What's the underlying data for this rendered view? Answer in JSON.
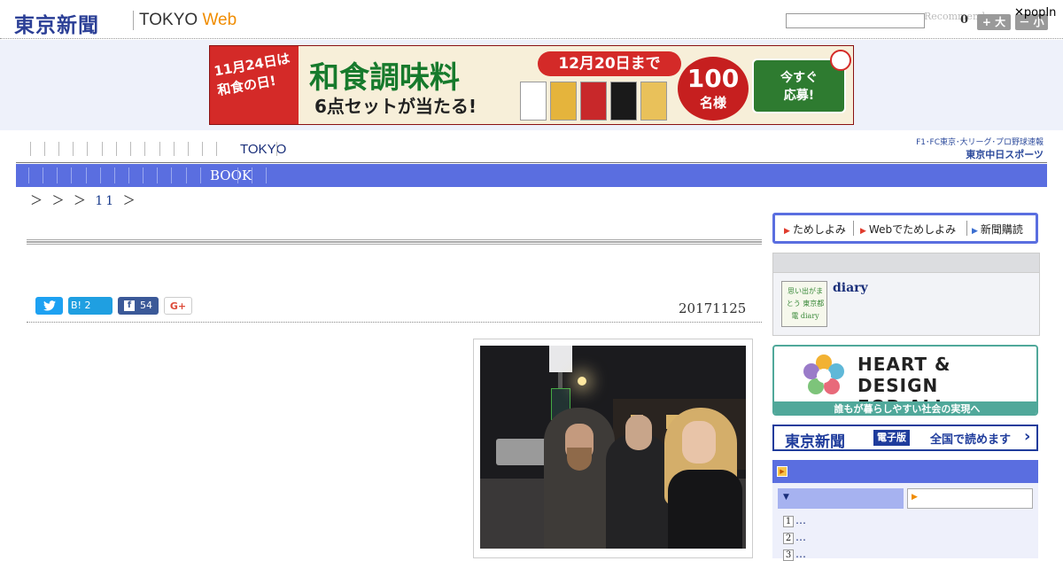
{
  "header": {
    "logo": "東京新聞",
    "site_name_prefix": "TOKYO ",
    "site_name_suffix": "Web",
    "search_placeholder": "",
    "recommend_label": "Recommend",
    "font_size_value": "0",
    "font_larger_label": "+ 大",
    "font_smaller_label": "－ 小",
    "popin_label": "✕popIn"
  },
  "ad": {
    "left_text_1": "11月24日は",
    "left_text_2": "和食の日!",
    "title": "和食調味料",
    "subtitle": "6点セットが当たる!",
    "deadline": "12月20日まで",
    "count": "100",
    "count_unit": "名様",
    "cta_line1": "今すぐ",
    "cta_line2": "応募!"
  },
  "nav": {
    "tokyo_label": "TOKYO",
    "chunichi_top": "F1･FC東京･大リーグ･プロ野球速報",
    "chunichi_bottom": "東京中日スポーツ",
    "book_label": "BOOK"
  },
  "breadcrumb": {
    "prefix": "＞ ＞ ＞",
    "link": "11",
    "suffix": "＞"
  },
  "article": {
    "date": "20171125",
    "share": {
      "twitter_icon": "twitter-icon",
      "hatena_label": "B! 2",
      "facebook_count": "54",
      "googleplus_label": "G+"
    }
  },
  "sidebar": {
    "subscribe": {
      "item1": "ためしよみ",
      "item2": "Webでためしよみ",
      "item3": "新聞購読"
    },
    "diary": {
      "thumb_text": "思い出がまとう 東京都電 diary",
      "link": "diary"
    },
    "heart_design": {
      "title_line1": "HEART & DESIGN",
      "title_line2": "FOR ALL",
      "tagline": "誰もが暮らしやすい社会の実現へ"
    },
    "edition": {
      "logo": "東京新聞",
      "tag": "電子版",
      "text": "全国で読めます"
    },
    "ranking": {
      "items": [
        {
          "num": "1",
          "text": "…"
        },
        {
          "num": "2",
          "text": "…"
        },
        {
          "num": "3",
          "text": "…"
        }
      ]
    }
  },
  "colors": {
    "brand_blue": "#2b3f96",
    "nav_blue": "#5a6ee0",
    "web_orange": "#f08c00",
    "hd_teal": "#50a89a"
  }
}
